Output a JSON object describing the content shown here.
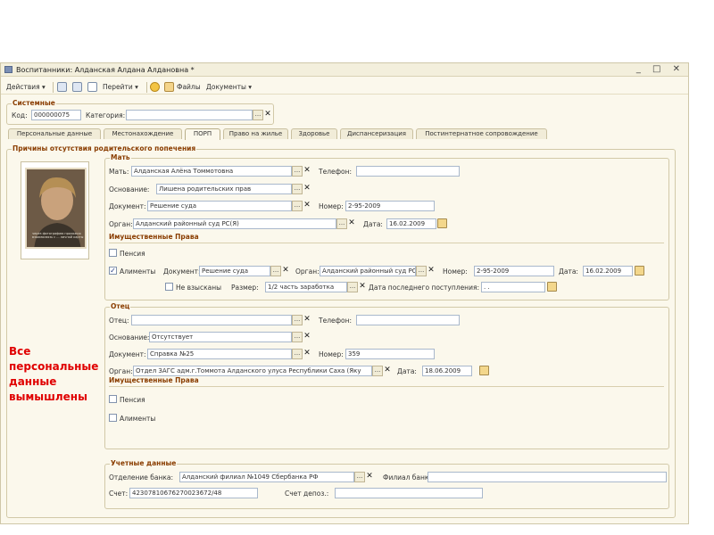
{
  "window": {
    "title": "Воспитанники: Алданская Алдана Алдановна *",
    "controls": "_ □ ✕"
  },
  "toolbar": {
    "actions": "Действия ▾",
    "goto": "Перейти ▾",
    "files": "Файлы",
    "documents": "Документы ▾"
  },
  "system": {
    "group": "Системные",
    "code_label": "Код:",
    "code_value": "000000075",
    "category_label": "Категория:",
    "category_value": ""
  },
  "tabs": [
    "Персональные данные",
    "Местонахождение",
    "ПОРП",
    "Право на жилье",
    "Здоровье",
    "Диспансеризация",
    "Постинтернатное сопровождение"
  ],
  "reasons_group": "Причины отсутствия родительского попечения",
  "photo_caption": "через фотографию прохожих\nвзаимосвязь с ...\nличной карты",
  "note": "Все персональные данные вымышлены",
  "mother": {
    "group": "Мать",
    "name_label": "Мать:",
    "name_value": "Алданская Алёна Томмотовна",
    "phone_label": "Телефон:",
    "phone_value": "",
    "basis_label": "Основание:",
    "basis_value": "Лишена родительских прав",
    "doc_label": "Документ:",
    "doc_value": "Решение суда",
    "number_label": "Номер:",
    "number_value": "2-95-2009",
    "organ_label": "Орган:",
    "organ_value": "Алданский районный суд РС(Я)",
    "date_label": "Дата:",
    "date_value": "16.02.2009",
    "property_head": "Имущественные Права",
    "pension_label": "Пенсия",
    "alimony_label": "Алименты",
    "alimony_checked": true,
    "al_doc_label": "Документ:",
    "al_doc_value": "Решение суда",
    "al_organ_label": "Орган:",
    "al_organ_value": "Алданский районный суд РС",
    "al_number_label": "Номер:",
    "al_number_value": "2-95-2009",
    "al_date_label": "Дата:",
    "al_date_value": "16.02.2009",
    "not_collected_label": "Не взысканы",
    "size_label": "Размер:",
    "size_value": "1/2 часть заработка",
    "last_receipt_label": "Дата последнего поступления:",
    "last_receipt_value": " .  ."
  },
  "father": {
    "group": "Отец",
    "name_label": "Отец:",
    "name_value": "",
    "phone_label": "Телефон:",
    "phone_value": "",
    "basis_label": "Основание:",
    "basis_value": "Отсутствует",
    "doc_label": "Документ:",
    "doc_value": "Справка №25",
    "number_label": "Номер:",
    "number_value": "359",
    "organ_label": "Орган:",
    "organ_value": "Отдел ЗАГС адм.г.Томмота Алданского улуса Республики Саха (Яку",
    "date_label": "Дата:",
    "date_value": "18.06.2009",
    "property_head": "Имущественные Права",
    "pension_label": "Пенсия",
    "alimony_label": "Алименты"
  },
  "bank": {
    "group": "Учетные данные",
    "branch_label": "Отделение банка:",
    "branch_value": "Алданский филиал №1049 Сбербанка РФ",
    "filial_label": "Филиал банка:",
    "filial_value": "",
    "account_label": "Счет:",
    "account_value": "42307810676270023672/48",
    "deposit_label": "Счет депоз.:",
    "deposit_value": ""
  }
}
